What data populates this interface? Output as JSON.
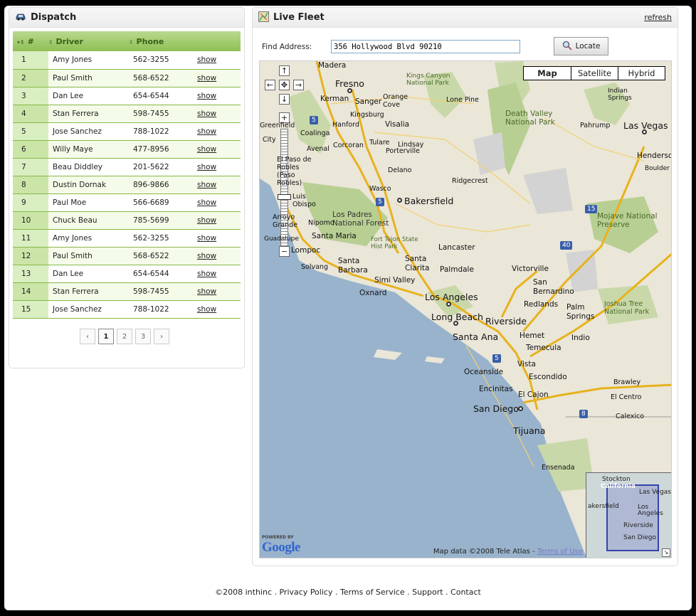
{
  "dispatch": {
    "title": "Dispatch",
    "columns": [
      "#",
      "Driver",
      "Phone",
      ""
    ],
    "rows": [
      {
        "num": "1",
        "driver": "Amy Jones",
        "phone": "562-3255",
        "link": "show"
      },
      {
        "num": "2",
        "driver": "Paul Smith",
        "phone": "568-6522",
        "link": "show"
      },
      {
        "num": "3",
        "driver": "Dan Lee",
        "phone": "654-6544",
        "link": "show"
      },
      {
        "num": "4",
        "driver": "Stan Ferrera",
        "phone": "598-7455",
        "link": "show"
      },
      {
        "num": "5",
        "driver": "Jose Sanchez",
        "phone": "788-1022",
        "link": "show"
      },
      {
        "num": "6",
        "driver": "Willy Maye",
        "phone": "477-8956",
        "link": "show"
      },
      {
        "num": "7",
        "driver": "Beau Diddley",
        "phone": "201-5622",
        "link": "show"
      },
      {
        "num": "8",
        "driver": "Dustin Dornak",
        "phone": "896-9866",
        "link": "show"
      },
      {
        "num": "9",
        "driver": "Paul Moe",
        "phone": "566-6689",
        "link": "show"
      },
      {
        "num": "10",
        "driver": "Chuck Beau",
        "phone": "785-5699",
        "link": "show"
      },
      {
        "num": "11",
        "driver": "Amy Jones",
        "phone": "562-3255",
        "link": "show"
      },
      {
        "num": "12",
        "driver": "Paul Smith",
        "phone": "568-6522",
        "link": "show"
      },
      {
        "num": "13",
        "driver": "Dan Lee",
        "phone": "654-6544",
        "link": "show"
      },
      {
        "num": "14",
        "driver": "Stan Ferrera",
        "phone": "598-7455",
        "link": "show"
      },
      {
        "num": "15",
        "driver": "Jose Sanchez",
        "phone": "788-1022",
        "link": "show"
      }
    ],
    "pager": {
      "prev": "‹",
      "pages": [
        "1",
        "2",
        "3"
      ],
      "current": "1",
      "next": "›"
    }
  },
  "fleet": {
    "title": "Live Fleet",
    "refresh": "refresh",
    "find_label": "Find Address:",
    "address_value": "356 Hollywood Blvd 90210",
    "locate_label": "Locate",
    "map_types": [
      "Map",
      "Satellite",
      "Hybrid"
    ],
    "map_type_selected": "Map",
    "powered_by": "POWERED BY",
    "google": "Google",
    "copyright": "Map data ©2008 Tele Atlas - ",
    "terms": "Terms of Use",
    "cities": {
      "madera": "Madera",
      "fresno": "Fresno",
      "kerman": "Kerman",
      "sanger": "Sanger",
      "orange_cove": "Orange Cove",
      "kings_canyon": "Kings Canyon National Park",
      "lone_pine": "Lone Pine",
      "death_valley": "Death Valley National Park",
      "indian_springs": "Indian Springs",
      "pahrump": "Pahrump",
      "las_vegas": "Las Vegas",
      "henderson": "Henderson",
      "boulder": "Boulder C",
      "kingsburg": "Kingsburg",
      "hanford": "Hanford",
      "visalia": "Visalia",
      "coalinga": "Coalinga",
      "corcoran": "Corcoran",
      "tulare": "Tulare",
      "lindsay": "Lindsay",
      "avenal": "Avenal",
      "porterville": "Porterville",
      "greenfield": "Greenfield",
      "city": "City",
      "paso": "El Paso de Robles (Paso Robles)",
      "delano": "Delano",
      "ridgecrest": "Ridgecrest",
      "wasco": "Wasco",
      "bakersfield": "Bakersfield",
      "luis": "Luis Obispo",
      "los_padres": "Los Padres National Forest",
      "mojave": "Mojave National Preserve",
      "arroyo": "Arroyo Grande",
      "nipomo": "Nipomo",
      "santa_maria": "Santa Maria",
      "guadalupe": "Guadalupe",
      "fort_tejon": "Fort Tejon State Hist Park",
      "lompoc": "Lompoc",
      "lancaster": "Lancaster",
      "solvang": "Solvang",
      "santa_barbara": "Santa Barbara",
      "santa_clarita": "Santa Clarita",
      "palmdale": "Palmdale",
      "victorville": "Victorville",
      "simi_valley": "Simi Valley",
      "san_bernardino": "San Bernardino",
      "oxnard": "Oxnard",
      "los_angeles": "Los Angeles",
      "redlands": "Redlands",
      "palm_springs": "Palm Springs",
      "joshua_tree": "Joshua Tree National Park",
      "long_beach": "Long Beach",
      "riverside": "Riverside",
      "santa_ana": "Santa Ana",
      "hemet": "Hemet",
      "indio": "Indio",
      "temecula": "Temecula",
      "vista": "Vista",
      "oceanside": "Oceanside",
      "escondido": "Escondido",
      "encinitas": "Encinitas",
      "brawley": "Brawley",
      "el_cajon": "El Cajon",
      "el_centro": "El Centro",
      "san_diego": "San Diego",
      "calexico": "Calexico",
      "tijuana": "Tijuana",
      "ensenada": "Ensenada"
    },
    "highways": [
      "5",
      "5",
      "15",
      "40",
      "5",
      "8"
    ],
    "overview_labels": [
      "Stockton",
      "California",
      "Las Vegas",
      "akersfield",
      "Los Angeles",
      "Riverside",
      "San Diego"
    ]
  },
  "footer": "©2008 inthinc . Privacy Policy . Terms of Service . Support . Contact"
}
